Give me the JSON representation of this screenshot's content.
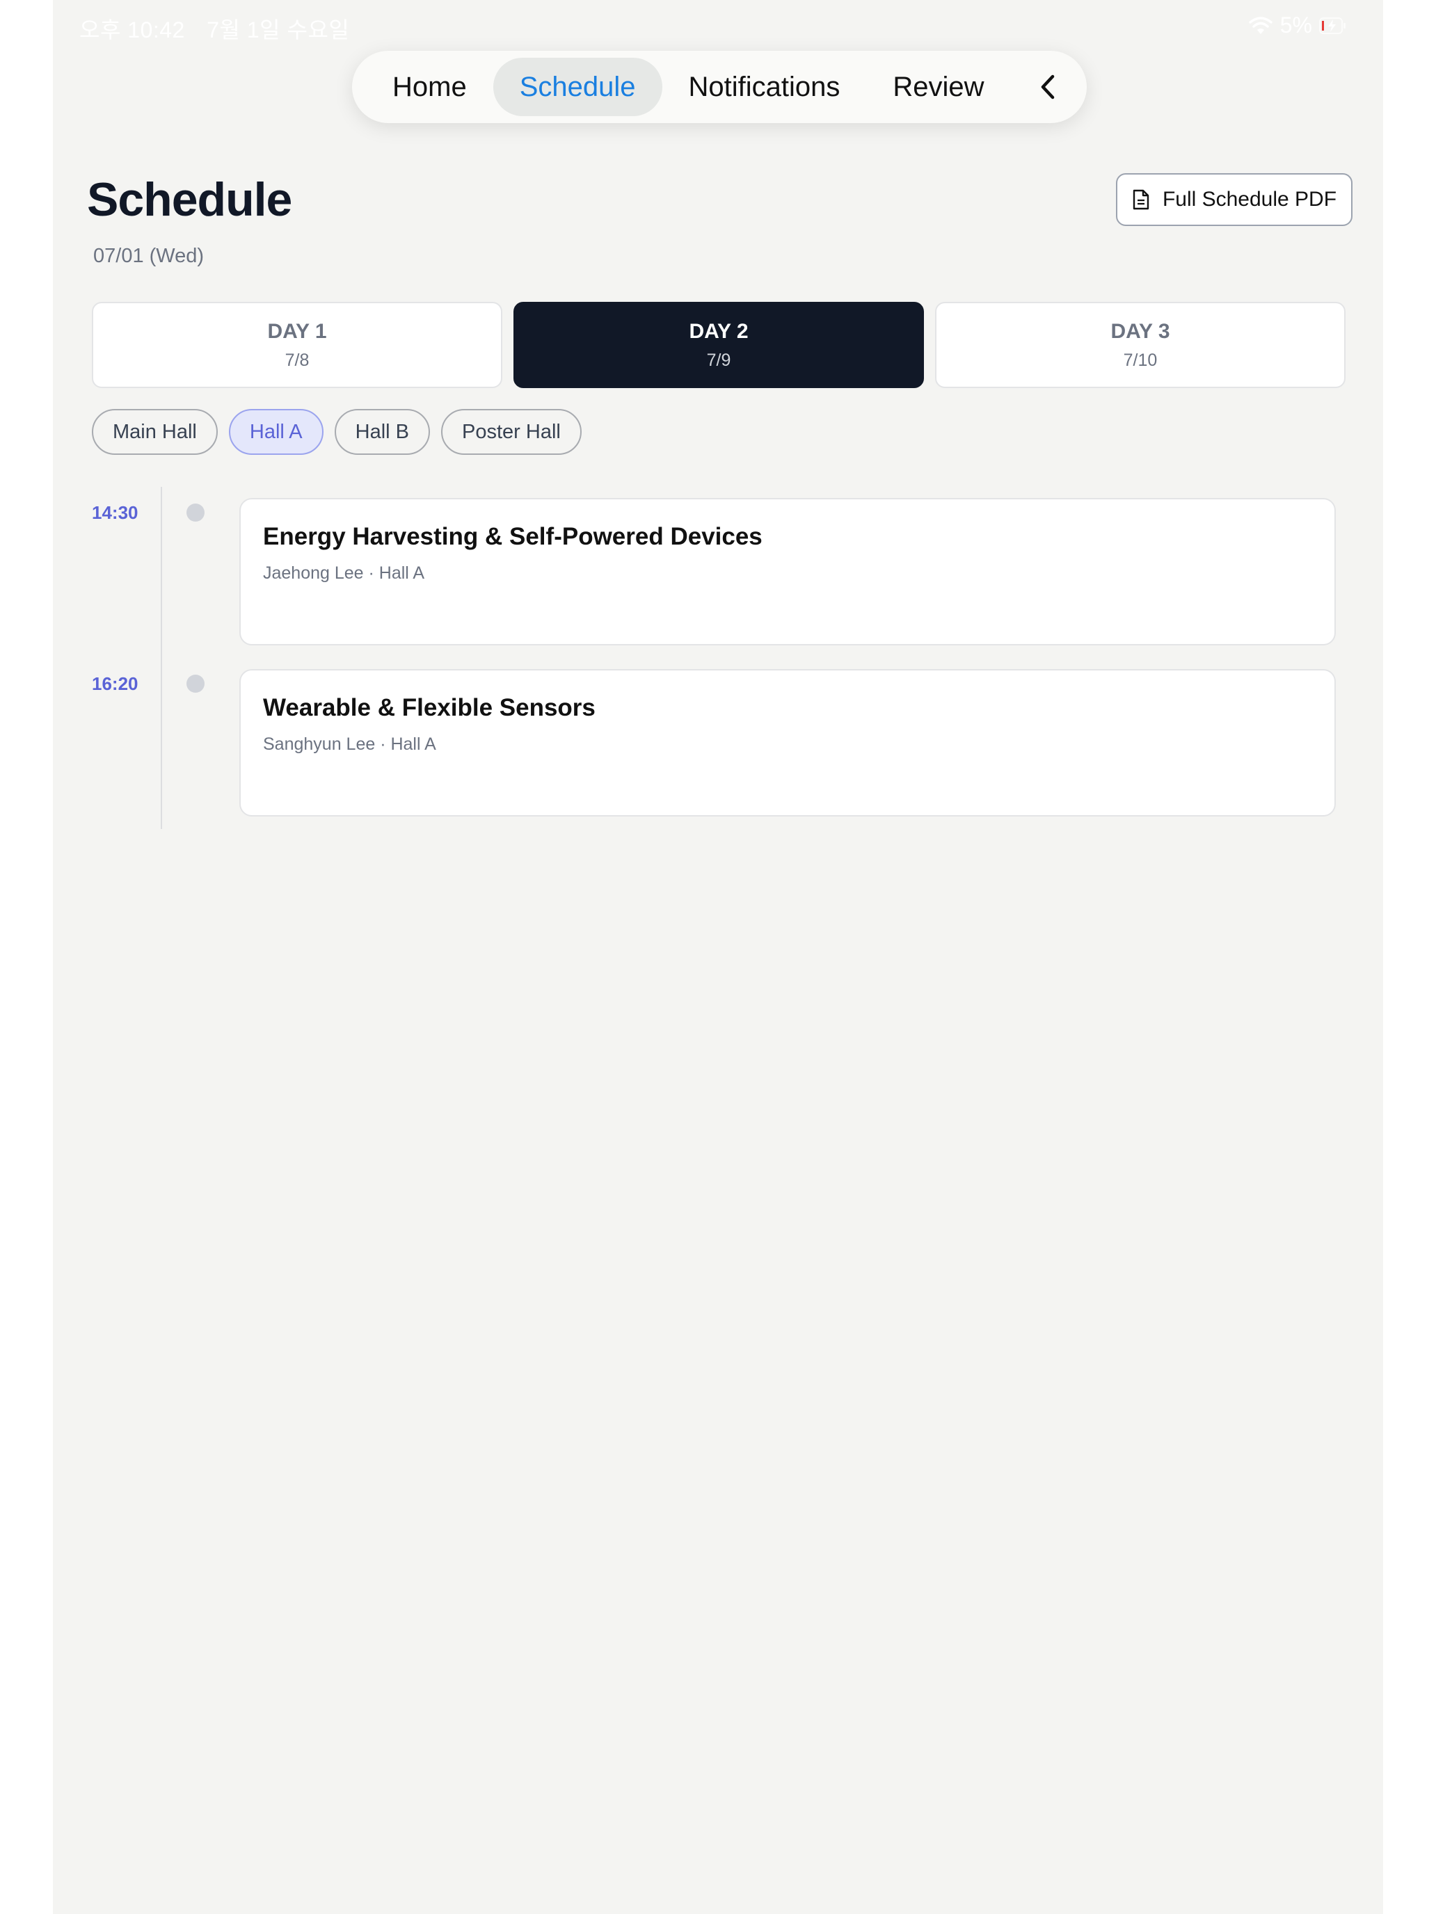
{
  "status_bar": {
    "time": "오후 10:42",
    "date": "7월 1일 수요일",
    "battery": "5%"
  },
  "nav": {
    "items": [
      {
        "label": "Home",
        "active": false
      },
      {
        "label": "Schedule",
        "active": true
      },
      {
        "label": "Notifications",
        "active": false
      },
      {
        "label": "Review",
        "active": false
      }
    ],
    "back_icon": "chevron-left-icon",
    "active_color": "#1a7fe0"
  },
  "header": {
    "title": "Schedule",
    "date": "07/01 (Wed)",
    "pdf_button": "Full Schedule PDF",
    "pdf_icon": "document-icon"
  },
  "day_tabs": [
    {
      "label": "DAY 1",
      "date": "7/8",
      "active": false
    },
    {
      "label": "DAY 2",
      "date": "7/9",
      "active": true
    },
    {
      "label": "DAY 3",
      "date": "7/10",
      "active": false
    }
  ],
  "halls": [
    {
      "label": "Main Hall",
      "active": false
    },
    {
      "label": "Hall A",
      "active": true
    },
    {
      "label": "Hall B",
      "active": false
    },
    {
      "label": "Poster Hall",
      "active": false
    }
  ],
  "sessions": [
    {
      "time": "14:30",
      "title": "Energy Harvesting & Self-Powered Devices",
      "meta": "Jaehong Lee · Hall A"
    },
    {
      "time": "16:20",
      "title": "Wearable & Flexible Sensors",
      "meta": "Sanghyun Lee · Hall A"
    }
  ],
  "colors": {
    "accent": "#5a63d6",
    "active_day_bg": "#111827",
    "background": "#f4f4f2"
  }
}
